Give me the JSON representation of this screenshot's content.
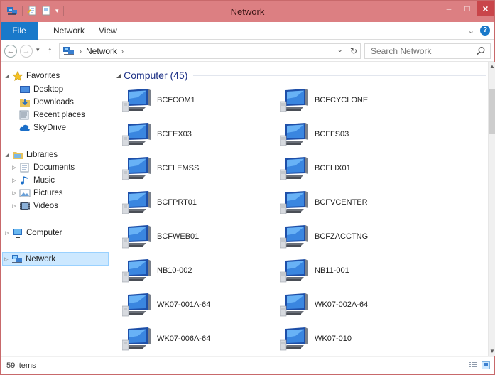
{
  "window": {
    "title": "Network",
    "accent": "#dc7f82",
    "close_color": "#c9454a",
    "minimize_glyph": "–",
    "maximize_glyph": "□",
    "close_glyph": "×"
  },
  "ribbon": {
    "tabs": [
      {
        "label": "File",
        "icon": "file-tab"
      },
      {
        "label": "Network",
        "icon": null
      },
      {
        "label": "View",
        "icon": null
      }
    ],
    "expand_glyph": "⌄",
    "help_glyph": "?"
  },
  "navigation": {
    "back_glyph": "←",
    "forward_glyph": "→",
    "recent_glyph": "▾",
    "up_glyph": "↑",
    "address": {
      "separator_glyph": "›",
      "breadcrumb": "Network",
      "dropdown_glyph": "⌄",
      "refresh_glyph": "↻"
    },
    "search": {
      "placeholder": "Search Network"
    }
  },
  "nav_pane": {
    "items": [
      {
        "label": "Favorites",
        "icon": "star-icon",
        "expanded": true,
        "indent": 0,
        "toggle": "◢"
      },
      {
        "label": "Desktop",
        "icon": "desktop-icon",
        "indent": 1
      },
      {
        "label": "Downloads",
        "icon": "downloads-icon",
        "indent": 1
      },
      {
        "label": "Recent places",
        "icon": "recent-places-icon",
        "indent": 1
      },
      {
        "label": "SkyDrive",
        "icon": "skydrive-icon",
        "indent": 1
      },
      {
        "label": "Libraries",
        "icon": "libraries-icon",
        "expanded": true,
        "indent": 0,
        "toggle": "◢"
      },
      {
        "label": "Documents",
        "icon": "documents-icon",
        "indent": 1,
        "toggle": "▷"
      },
      {
        "label": "Music",
        "icon": "music-icon",
        "indent": 1,
        "toggle": "▷"
      },
      {
        "label": "Pictures",
        "icon": "pictures-icon",
        "indent": 1,
        "toggle": "▷"
      },
      {
        "label": "Videos",
        "icon": "videos-icon",
        "indent": 1,
        "toggle": "▷"
      },
      {
        "label": "Computer",
        "icon": "computer-icon",
        "indent": 0,
        "toggle": "▷"
      },
      {
        "label": "Network",
        "icon": "network-icon",
        "indent": 0,
        "selected": true,
        "toggle": "▷"
      }
    ]
  },
  "content": {
    "group": {
      "title": "Computer (45)",
      "toggle": "◢"
    },
    "computers": [
      "BCFCOM1",
      "BCFCYCLONE",
      "BCFEX03",
      "BCFFS03",
      "BCFLEMSS",
      "BCFLIX01",
      "BCFPRT01",
      "BCFVCENTER",
      "BCFWEB01",
      "BCFZACCTNG",
      "NB10-002",
      "NB11-001",
      "WK07-001A-64",
      "WK07-002A-64",
      "WK07-006A-64",
      "WK07-010"
    ]
  },
  "scrollbar": {
    "up_glyph": "▲",
    "down_glyph": "▼",
    "position": 0.0
  },
  "status": {
    "item_count": "59 items"
  }
}
